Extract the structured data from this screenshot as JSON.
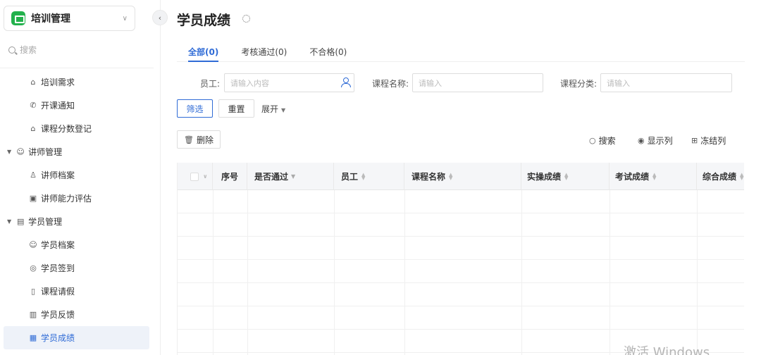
{
  "app": {
    "name": "培训管理"
  },
  "sidebar": {
    "search_placeholder": "搜索",
    "items": [
      {
        "label": "培训需求",
        "icon": "graduation-cap-icon",
        "glyph": "⌂",
        "type": "child"
      },
      {
        "label": "开课通知",
        "icon": "phone-icon",
        "glyph": "✆",
        "type": "child"
      },
      {
        "label": "课程分数登记",
        "icon": "graduation-cap-icon",
        "glyph": "⌂",
        "type": "child"
      },
      {
        "label": "讲师管理",
        "icon": "users-icon",
        "glyph": "☺",
        "type": "group"
      },
      {
        "label": "讲师档案",
        "icon": "user-icon",
        "glyph": "♙",
        "type": "child"
      },
      {
        "label": "讲师能力评估",
        "icon": "chart-icon",
        "glyph": "▣",
        "type": "child"
      },
      {
        "label": "学员管理",
        "icon": "id-card-icon",
        "glyph": "▤",
        "type": "group"
      },
      {
        "label": "学员档案",
        "icon": "users-icon",
        "glyph": "☺",
        "type": "child"
      },
      {
        "label": "学员签到",
        "icon": "location-icon",
        "glyph": "◎",
        "type": "child"
      },
      {
        "label": "课程请假",
        "icon": "phone-device-icon",
        "glyph": "▯",
        "type": "child"
      },
      {
        "label": "学员反馈",
        "icon": "document-icon",
        "glyph": "▥",
        "type": "child"
      },
      {
        "label": "学员成绩",
        "icon": "cards-icon",
        "glyph": "▦",
        "type": "child",
        "active": true
      }
    ]
  },
  "page": {
    "title": "学员成绩"
  },
  "tabs": [
    {
      "label": "全部(0)",
      "active": true
    },
    {
      "label": "考核通过(0)"
    },
    {
      "label": "不合格(0)"
    }
  ],
  "filters": {
    "employee_label": "员工:",
    "employee_placeholder": "请输入内容",
    "course_name_label": "课程名称:",
    "course_name_placeholder": "请输入",
    "course_category_label": "课程分类:",
    "course_category_placeholder": "请输入",
    "filter_button": "筛选",
    "reset_button": "重置",
    "expand_label": "展开"
  },
  "toolbar": {
    "delete_label": "删除",
    "search_label": "搜索",
    "columns_label": "显示列",
    "freeze_label": "冻结列"
  },
  "table": {
    "columns": [
      "序号",
      "是否通过",
      "员工",
      "课程名称",
      "实操成绩",
      "考试成绩",
      "综合成绩"
    ],
    "rows": []
  },
  "watermark": "激活 Windows"
}
